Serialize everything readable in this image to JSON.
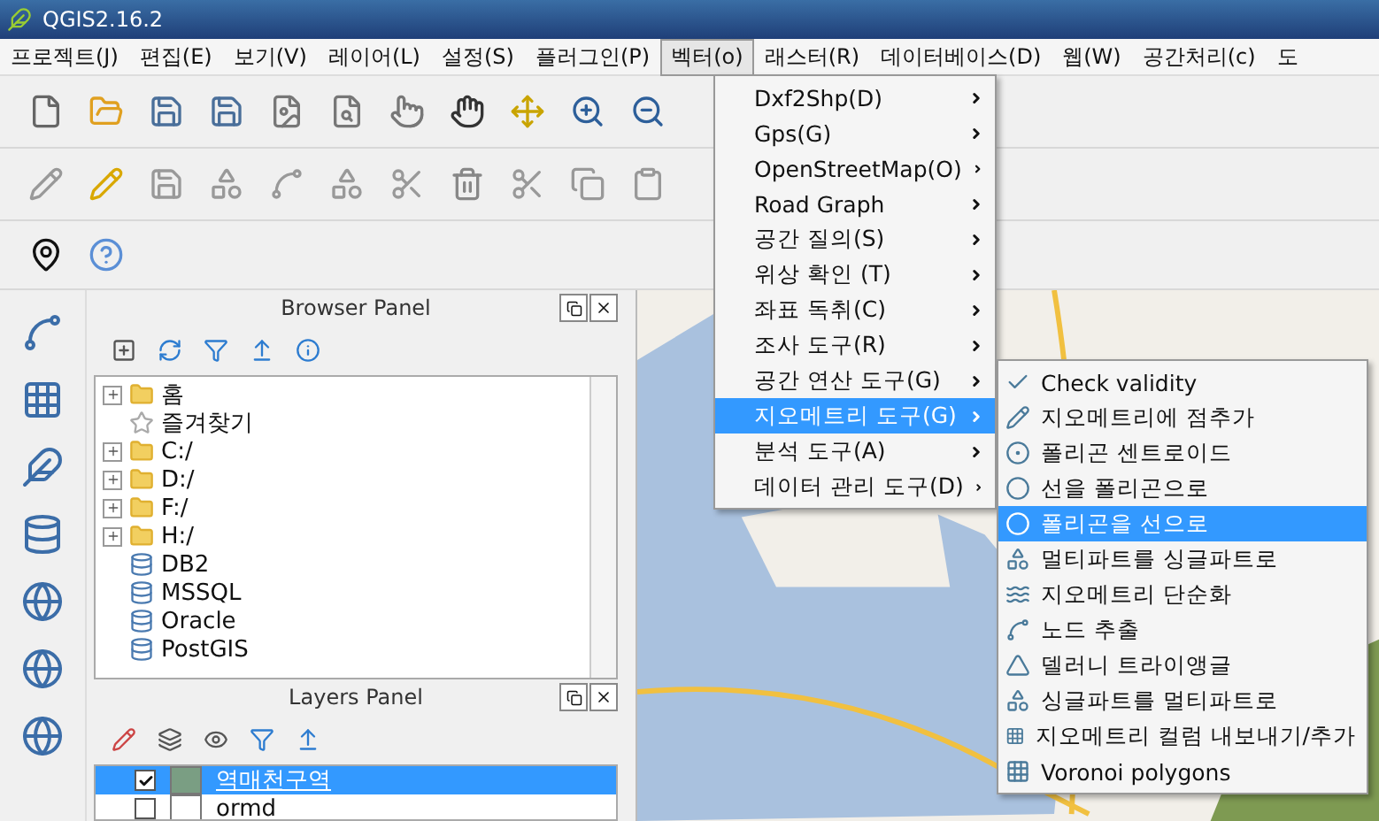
{
  "window": {
    "title": "QGIS2.16.2"
  },
  "menu_bar": [
    {
      "label": "프로젝트(J)",
      "selected": false
    },
    {
      "label": "편집(E)",
      "selected": false
    },
    {
      "label": "보기(V)",
      "selected": false
    },
    {
      "label": "레이어(L)",
      "selected": false
    },
    {
      "label": "설정(S)",
      "selected": false
    },
    {
      "label": "플러그인(P)",
      "selected": false
    },
    {
      "label": "벡터(o)",
      "selected": true
    },
    {
      "label": "래스터(R)",
      "selected": false
    },
    {
      "label": "데이터베이스(D)",
      "selected": false
    },
    {
      "label": "웹(W)",
      "selected": false
    },
    {
      "label": "공간처리(c)",
      "selected": false
    },
    {
      "label": "도",
      "selected": false
    }
  ],
  "vector_menu": {
    "items": [
      {
        "label": "Dxf2Shp(D)",
        "selected": false
      },
      {
        "label": "Gps(G)",
        "selected": false
      },
      {
        "label": "OpenStreetMap(O)",
        "selected": false
      },
      {
        "label": "Road Graph",
        "selected": false
      },
      {
        "label": "공간 질의(S)",
        "selected": false
      },
      {
        "label": "위상 확인 (T)",
        "selected": false
      },
      {
        "label": "좌표 독취(C)",
        "selected": false
      },
      {
        "label": "조사 도구(R)",
        "selected": false
      },
      {
        "label": "공간 연산 도구(G)",
        "selected": false
      },
      {
        "label": "지오메트리 도구(G)",
        "selected": true
      },
      {
        "label": "분석 도구(A)",
        "selected": false
      },
      {
        "label": "데이터 관리 도구(D)",
        "selected": false
      }
    ]
  },
  "geometry_submenu": {
    "items": [
      {
        "label": "Check validity",
        "selected": false
      },
      {
        "label": "지오메트리에 점추가",
        "selected": false
      },
      {
        "label": "폴리곤 센트로이드",
        "selected": false
      },
      {
        "label": "선을 폴리곤으로",
        "selected": false
      },
      {
        "label": "폴리곤을 선으로",
        "selected": true
      },
      {
        "label": "멀티파트를 싱글파트로",
        "selected": false
      },
      {
        "label": "지오메트리 단순화",
        "selected": false
      },
      {
        "label": "노드 추출",
        "selected": false
      },
      {
        "label": "델러니 트라이앵글",
        "selected": false
      },
      {
        "label": "싱글파트를 멀티파트로",
        "selected": false
      },
      {
        "label": "지오메트리 컬럼 내보내기/추가",
        "selected": false
      },
      {
        "label": "Voronoi polygons",
        "selected": false
      }
    ]
  },
  "browser_panel": {
    "title": "Browser Panel",
    "items": [
      {
        "label": "홈",
        "kind": "folder",
        "expandable": true
      },
      {
        "label": "즐겨찾기",
        "kind": "favorites",
        "expandable": false
      },
      {
        "label": "C:/",
        "kind": "folder",
        "expandable": true
      },
      {
        "label": "D:/",
        "kind": "folder",
        "expandable": true
      },
      {
        "label": "F:/",
        "kind": "folder",
        "expandable": true
      },
      {
        "label": "H:/",
        "kind": "folder",
        "expandable": true
      },
      {
        "label": "DB2",
        "kind": "database",
        "expandable": false
      },
      {
        "label": "MSSQL",
        "kind": "database",
        "expandable": false
      },
      {
        "label": "Oracle",
        "kind": "database",
        "expandable": false
      },
      {
        "label": "PostGIS",
        "kind": "database",
        "expandable": false
      }
    ]
  },
  "layers_panel": {
    "title": "Layers Panel",
    "layers": [
      {
        "name": "역매천구역",
        "visible": true,
        "selected": true,
        "color": "#7a9e83"
      },
      {
        "name": "ormd",
        "visible": false,
        "selected": false,
        "color": "#ffffff"
      }
    ]
  }
}
